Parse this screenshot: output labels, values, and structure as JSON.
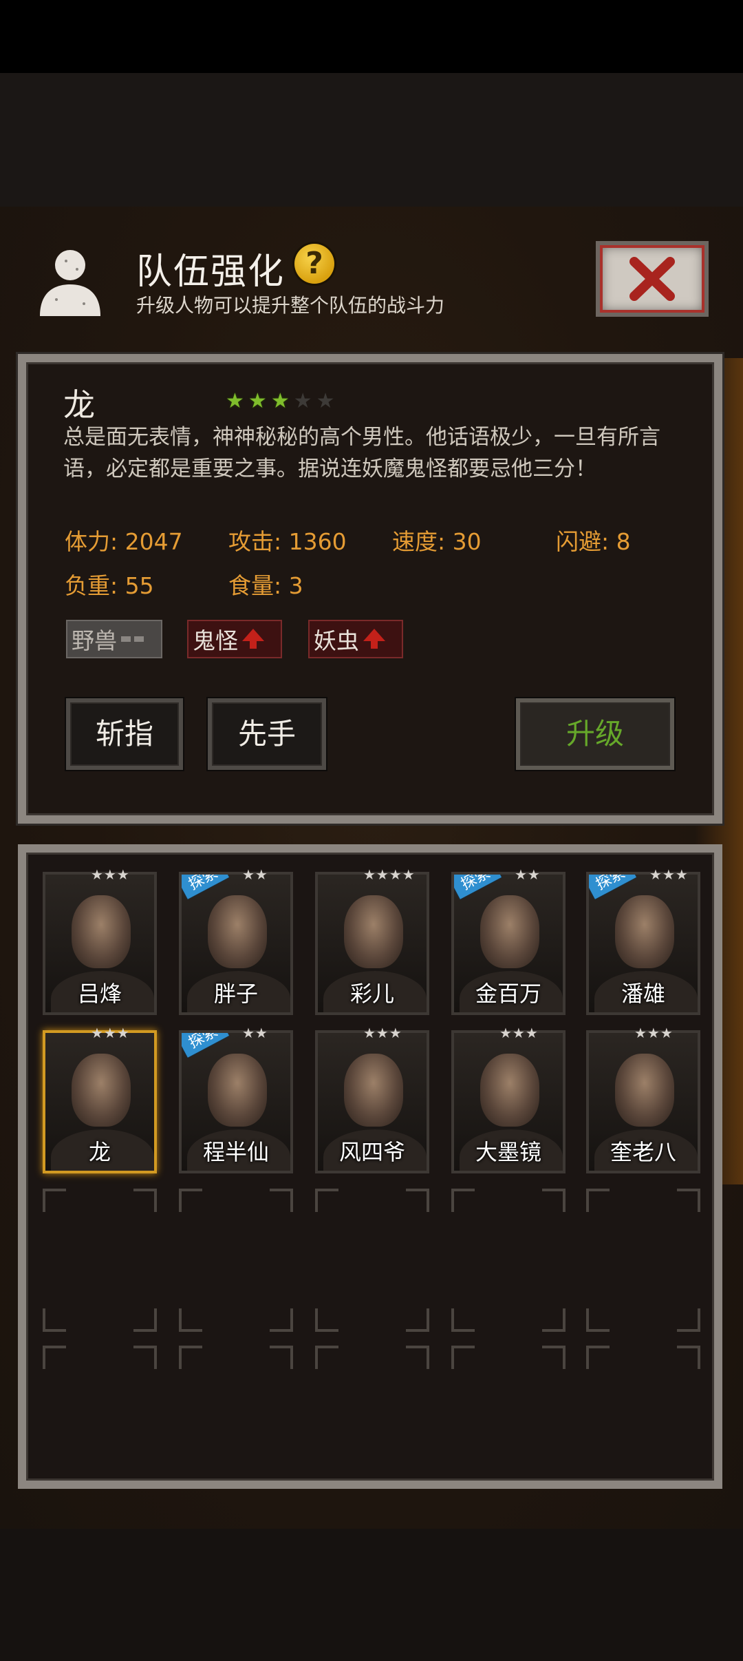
{
  "header": {
    "title": "队伍强化",
    "subtitle": "升级人物可以提升整个队伍的战斗力",
    "help_label": "?"
  },
  "character": {
    "name": "龙",
    "stars": 3,
    "max_stars": 5,
    "description": "总是面无表情，神神秘秘的高个男性。他话语极少，一旦有所言语，必定都是重要之事。据说连妖魔鬼怪都要忌他三分！",
    "stats": {
      "hp": "体力: 2047",
      "attack": "攻击: 1360",
      "speed": "速度: 30",
      "dodge": "闪避: 8",
      "load": "负重: 55",
      "food": "食量: 3"
    },
    "tags": [
      {
        "label": "野兽",
        "state": "neutral"
      },
      {
        "label": "鬼怪",
        "state": "up"
      },
      {
        "label": "妖虫",
        "state": "up"
      }
    ]
  },
  "buttons": {
    "skill1": "斩指",
    "skill2": "先手",
    "upgrade": "升级"
  },
  "roster": [
    {
      "name": "吕烽",
      "stars": "★★★",
      "explore": false
    },
    {
      "name": "胖子",
      "stars": "★★",
      "explore": true
    },
    {
      "name": "彩儿",
      "stars": "★★★★",
      "explore": false
    },
    {
      "name": "金百万",
      "stars": "★★",
      "explore": true
    },
    {
      "name": "潘雄",
      "stars": "★★★",
      "explore": true
    },
    {
      "name": "龙",
      "stars": "★★★",
      "explore": false,
      "selected": true
    },
    {
      "name": "程半仙",
      "stars": "★★",
      "explore": true
    },
    {
      "name": "风四爷",
      "stars": "★★★",
      "explore": false
    },
    {
      "name": "大墨镜",
      "stars": "★★★",
      "explore": false
    },
    {
      "name": "奎老八",
      "stars": "★★★",
      "explore": false
    }
  ],
  "explore_label": "探索",
  "colors": {
    "stat_text": "#e59c34",
    "upgrade_text": "#66a82a",
    "star_on": "#7fbd2c",
    "explore_badge": "#2f8fd0",
    "selected_border": "#d29a22"
  }
}
